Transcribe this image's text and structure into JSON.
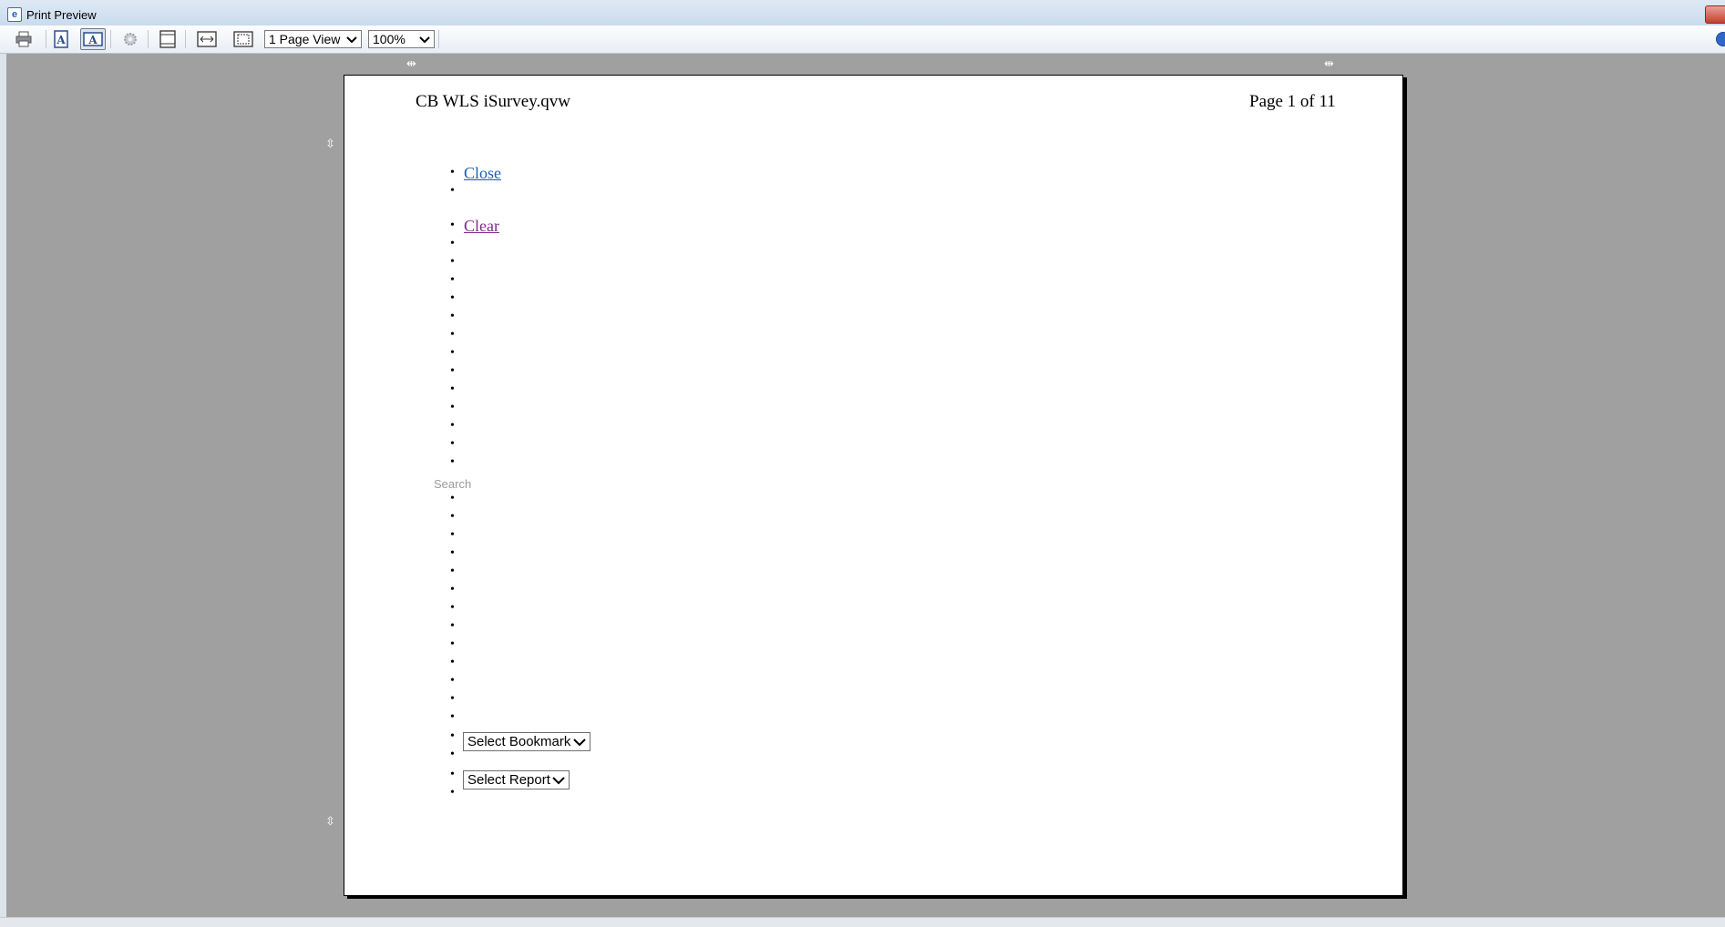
{
  "window": {
    "title": "Print Preview"
  },
  "toolbar": {
    "buttons": [
      {
        "name": "print-icon"
      },
      {
        "name": "portrait-icon"
      },
      {
        "name": "landscape-icon"
      },
      {
        "name": "page-setup-icon"
      },
      {
        "name": "turn-headers-footers-icon"
      },
      {
        "name": "full-width-icon"
      },
      {
        "name": "full-page-icon"
      }
    ],
    "view_select": "1 Page View",
    "zoom_select": "100%"
  },
  "page": {
    "header_left": "CB WLS iSurvey.qvw",
    "header_right": "Page 1 of 11",
    "close_link": "Close",
    "clear_link": "Clear",
    "search_label": "Search",
    "select_bookmark": "Select Bookmark",
    "select_report": "Select Report",
    "bullet_char": "•"
  },
  "colors": {
    "link_unvisited": "#1a5fb4",
    "link_visited": "#7b2b8a",
    "preview_background": "#a0a0a0"
  }
}
